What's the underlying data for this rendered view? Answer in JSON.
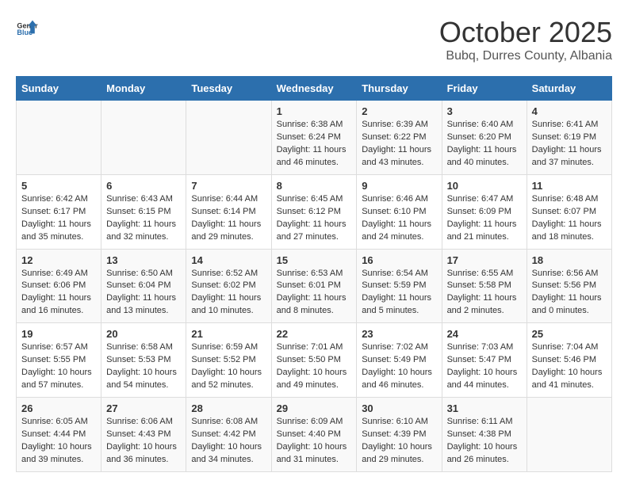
{
  "logo": {
    "general": "General",
    "blue": "Blue"
  },
  "header": {
    "month": "October 2025",
    "location": "Bubq, Durres County, Albania"
  },
  "days_of_week": [
    "Sunday",
    "Monday",
    "Tuesday",
    "Wednesday",
    "Thursday",
    "Friday",
    "Saturday"
  ],
  "weeks": [
    [
      {
        "day": "",
        "info": ""
      },
      {
        "day": "",
        "info": ""
      },
      {
        "day": "",
        "info": ""
      },
      {
        "day": "1",
        "info": "Sunrise: 6:38 AM\nSunset: 6:24 PM\nDaylight: 11 hours and 46 minutes."
      },
      {
        "day": "2",
        "info": "Sunrise: 6:39 AM\nSunset: 6:22 PM\nDaylight: 11 hours and 43 minutes."
      },
      {
        "day": "3",
        "info": "Sunrise: 6:40 AM\nSunset: 6:20 PM\nDaylight: 11 hours and 40 minutes."
      },
      {
        "day": "4",
        "info": "Sunrise: 6:41 AM\nSunset: 6:19 PM\nDaylight: 11 hours and 37 minutes."
      }
    ],
    [
      {
        "day": "5",
        "info": "Sunrise: 6:42 AM\nSunset: 6:17 PM\nDaylight: 11 hours and 35 minutes."
      },
      {
        "day": "6",
        "info": "Sunrise: 6:43 AM\nSunset: 6:15 PM\nDaylight: 11 hours and 32 minutes."
      },
      {
        "day": "7",
        "info": "Sunrise: 6:44 AM\nSunset: 6:14 PM\nDaylight: 11 hours and 29 minutes."
      },
      {
        "day": "8",
        "info": "Sunrise: 6:45 AM\nSunset: 6:12 PM\nDaylight: 11 hours and 27 minutes."
      },
      {
        "day": "9",
        "info": "Sunrise: 6:46 AM\nSunset: 6:10 PM\nDaylight: 11 hours and 24 minutes."
      },
      {
        "day": "10",
        "info": "Sunrise: 6:47 AM\nSunset: 6:09 PM\nDaylight: 11 hours and 21 minutes."
      },
      {
        "day": "11",
        "info": "Sunrise: 6:48 AM\nSunset: 6:07 PM\nDaylight: 11 hours and 18 minutes."
      }
    ],
    [
      {
        "day": "12",
        "info": "Sunrise: 6:49 AM\nSunset: 6:06 PM\nDaylight: 11 hours and 16 minutes."
      },
      {
        "day": "13",
        "info": "Sunrise: 6:50 AM\nSunset: 6:04 PM\nDaylight: 11 hours and 13 minutes."
      },
      {
        "day": "14",
        "info": "Sunrise: 6:52 AM\nSunset: 6:02 PM\nDaylight: 11 hours and 10 minutes."
      },
      {
        "day": "15",
        "info": "Sunrise: 6:53 AM\nSunset: 6:01 PM\nDaylight: 11 hours and 8 minutes."
      },
      {
        "day": "16",
        "info": "Sunrise: 6:54 AM\nSunset: 5:59 PM\nDaylight: 11 hours and 5 minutes."
      },
      {
        "day": "17",
        "info": "Sunrise: 6:55 AM\nSunset: 5:58 PM\nDaylight: 11 hours and 2 minutes."
      },
      {
        "day": "18",
        "info": "Sunrise: 6:56 AM\nSunset: 5:56 PM\nDaylight: 11 hours and 0 minutes."
      }
    ],
    [
      {
        "day": "19",
        "info": "Sunrise: 6:57 AM\nSunset: 5:55 PM\nDaylight: 10 hours and 57 minutes."
      },
      {
        "day": "20",
        "info": "Sunrise: 6:58 AM\nSunset: 5:53 PM\nDaylight: 10 hours and 54 minutes."
      },
      {
        "day": "21",
        "info": "Sunrise: 6:59 AM\nSunset: 5:52 PM\nDaylight: 10 hours and 52 minutes."
      },
      {
        "day": "22",
        "info": "Sunrise: 7:01 AM\nSunset: 5:50 PM\nDaylight: 10 hours and 49 minutes."
      },
      {
        "day": "23",
        "info": "Sunrise: 7:02 AM\nSunset: 5:49 PM\nDaylight: 10 hours and 46 minutes."
      },
      {
        "day": "24",
        "info": "Sunrise: 7:03 AM\nSunset: 5:47 PM\nDaylight: 10 hours and 44 minutes."
      },
      {
        "day": "25",
        "info": "Sunrise: 7:04 AM\nSunset: 5:46 PM\nDaylight: 10 hours and 41 minutes."
      }
    ],
    [
      {
        "day": "26",
        "info": "Sunrise: 6:05 AM\nSunset: 4:44 PM\nDaylight: 10 hours and 39 minutes."
      },
      {
        "day": "27",
        "info": "Sunrise: 6:06 AM\nSunset: 4:43 PM\nDaylight: 10 hours and 36 minutes."
      },
      {
        "day": "28",
        "info": "Sunrise: 6:08 AM\nSunset: 4:42 PM\nDaylight: 10 hours and 34 minutes."
      },
      {
        "day": "29",
        "info": "Sunrise: 6:09 AM\nSunset: 4:40 PM\nDaylight: 10 hours and 31 minutes."
      },
      {
        "day": "30",
        "info": "Sunrise: 6:10 AM\nSunset: 4:39 PM\nDaylight: 10 hours and 29 minutes."
      },
      {
        "day": "31",
        "info": "Sunrise: 6:11 AM\nSunset: 4:38 PM\nDaylight: 10 hours and 26 minutes."
      },
      {
        "day": "",
        "info": ""
      }
    ]
  ]
}
